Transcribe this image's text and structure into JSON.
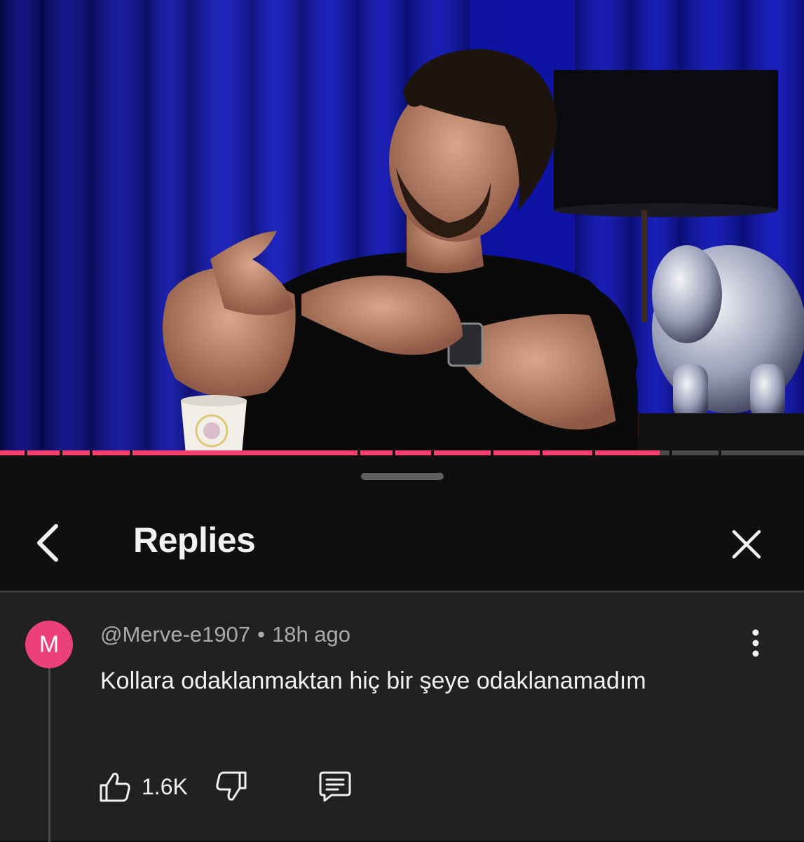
{
  "video": {
    "progress_fraction": 0.82
  },
  "header": {
    "title": "Replies",
    "back_icon": "chevron-left-icon",
    "close_icon": "close-icon"
  },
  "comment": {
    "avatar_letter": "M",
    "avatar_color": "#ec407a",
    "author": "@Merve-e1907",
    "separator": "•",
    "time": "18h ago",
    "text": "Kollara odaklanmaktan hiç bir şeye odaklanamadım",
    "like_count": "1.6K"
  },
  "colors": {
    "accent": "#ff3d6e",
    "background": "#0f0f0f",
    "comment_bg": "#212121",
    "text_primary": "#f1f1f1",
    "text_secondary": "#aaaaaa"
  }
}
